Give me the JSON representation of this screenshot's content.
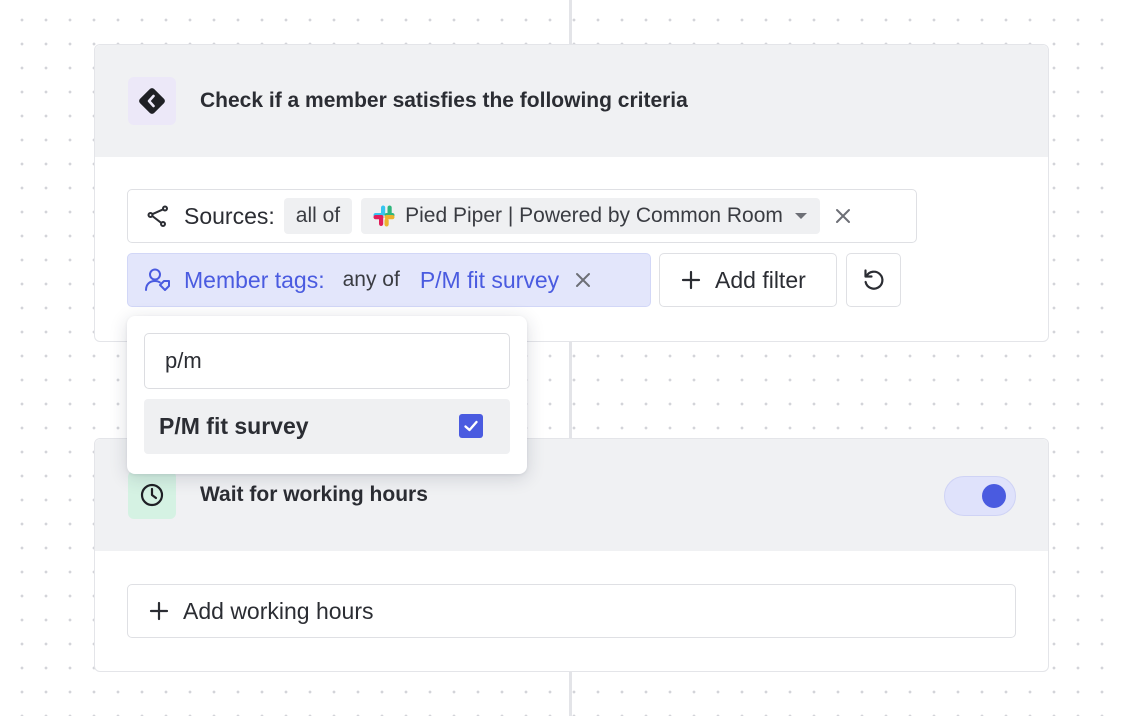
{
  "criteria_step": {
    "title": "Check if a member satisfies the following criteria",
    "sources_filter": {
      "label": "Sources:",
      "operator": "all of",
      "value": "Pied Piper | Powered by Common Room"
    },
    "member_tags_filter": {
      "label": "Member tags:",
      "operator": "any of",
      "value": "P/M fit survey"
    },
    "add_filter_label": "Add filter"
  },
  "tag_dropdown": {
    "search_value": "p/m",
    "options": [
      {
        "label": "P/M fit survey",
        "checked": true
      }
    ]
  },
  "wait_step": {
    "title": "Wait for working hours",
    "enabled": true,
    "add_hours_label": "Add working hours"
  },
  "colors": {
    "accent": "#4a5be0",
    "tag_chip_bg": "#e3e6fb",
    "criteria_icon_bg": "#ece8f8",
    "wait_icon_bg": "#d5f2e3"
  },
  "icons": {
    "criteria": "diamond-arrow-icon",
    "sources": "share-nodes-icon",
    "source_app": "slack-icon",
    "member_tags": "user-tag-icon",
    "reset": "undo-icon",
    "wait": "clock-icon"
  }
}
